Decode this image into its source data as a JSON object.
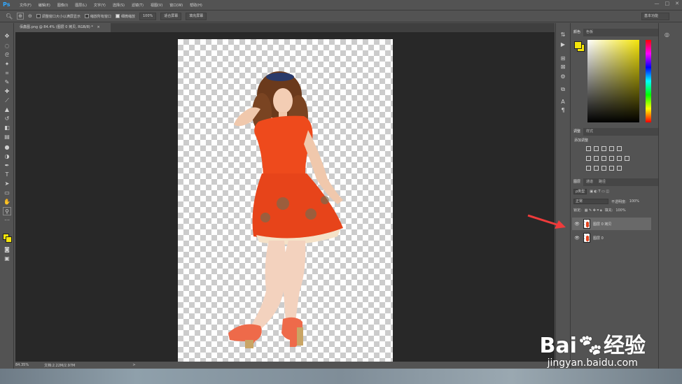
{
  "app": {
    "logo": "Ps"
  },
  "menu": [
    "文件(F)",
    "编辑(E)",
    "图像(I)",
    "图层(L)",
    "文字(Y)",
    "选择(S)",
    "滤镜(T)",
    "视图(V)",
    "窗口(W)",
    "帮助(H)"
  ],
  "window_controls": {
    "minimize": "—",
    "maximize": "□",
    "close": "✕"
  },
  "options": {
    "resize_windows": "调整窗口大小以满屏显示",
    "zoom_all": "缩放所有窗口",
    "scrubby_zoom": "细微缩放",
    "scrubby_checked": true,
    "zoom_level": "100%",
    "fit_screen": "适合屏幕",
    "fill_screen": "填充屏幕",
    "workspace": "基本功能"
  },
  "document": {
    "tab_label": "佰鑫图.png @ 84.4% (图层 0 拷贝, RGB/8) *",
    "tab_close": "×"
  },
  "status": {
    "zoom": "84.35%",
    "doc_size": "文档:2.22M/2.97M",
    "arrow": ">"
  },
  "color_panel": {
    "tabs": [
      "颜色",
      "色板"
    ],
    "fg_color": "#f5e50a",
    "bg_color": "#f5e50a"
  },
  "adjust_panel": {
    "tabs": [
      "调整",
      "样式"
    ],
    "title": "添加调整"
  },
  "layers_panel": {
    "tabs": [
      "图层",
      "通道",
      "路径"
    ],
    "filter_kind": "ρ类型",
    "blend_mode": "正常",
    "opacity_label": "不透明度:",
    "opacity_value": "100%",
    "lock_label": "锁定:",
    "fill_label": "填充:",
    "fill_value": "100%",
    "layers": [
      {
        "name": "图层 0 拷贝",
        "visible": true,
        "selected": true
      },
      {
        "name": "图层 0",
        "visible": true,
        "selected": false
      }
    ]
  },
  "annotation": {
    "arrow_color": "#ef3b3b"
  },
  "watermark": {
    "brand": "Bai",
    "brand_cn": "经验",
    "url": "jingyan.baidu.com"
  }
}
